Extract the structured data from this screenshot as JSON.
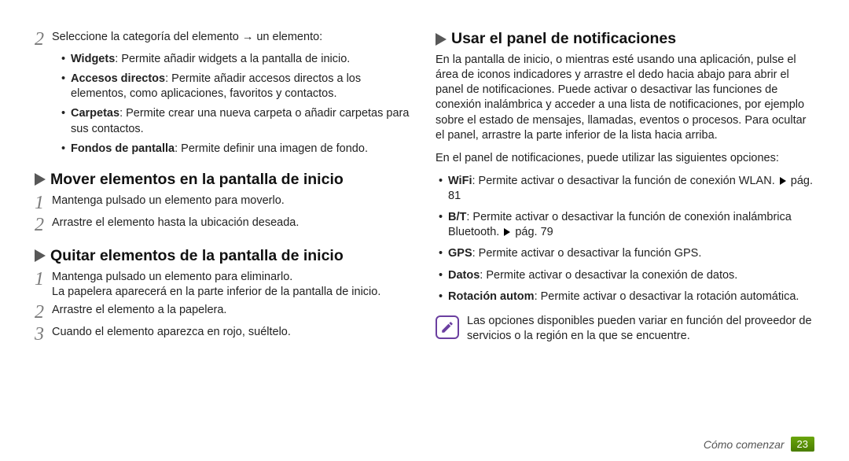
{
  "left": {
    "step2_intro": "Seleccione la categoría del elemento → un elemento:",
    "step2_num": "2",
    "bullets": [
      {
        "label": "Widgets",
        "text": ": Permite añadir widgets a la pantalla de inicio."
      },
      {
        "label": "Accesos directos",
        "text": ": Permite añadir accesos directos a los elementos, como aplicaciones, favoritos y contactos."
      },
      {
        "label": "Carpetas",
        "text": ": Permite crear una nueva carpeta o añadir carpetas para sus contactos."
      },
      {
        "label": "Fondos de pantalla",
        "text": ": Permite definir una imagen de fondo."
      }
    ],
    "sec_move_title": "Mover elementos en la pantalla de inicio",
    "move_steps": [
      {
        "num": "1",
        "text": "Mantenga pulsado un elemento para moverlo."
      },
      {
        "num": "2",
        "text": "Arrastre el elemento hasta la ubicación deseada."
      }
    ],
    "sec_remove_title": "Quitar elementos de la pantalla de inicio",
    "remove_steps": [
      {
        "num": "1",
        "text": "Mantenga pulsado un elemento para eliminarlo.",
        "extra": "La papelera aparecerá en la parte inferior de la pantalla de inicio."
      },
      {
        "num": "2",
        "text": "Arrastre el elemento a la papelera."
      },
      {
        "num": "3",
        "text": "Cuando el elemento aparezca en rojo, suéltelo."
      }
    ]
  },
  "right": {
    "sec_notif_title": "Usar el panel de notificaciones",
    "para1": "En la pantalla de inicio, o mientras esté usando una aplicación, pulse el área de iconos indicadores y arrastre el dedo hacia abajo para abrir el panel de notificaciones. Puede activar o desactivar las funciones de conexión inalámbrica y acceder a una lista de notificaciones, por ejemplo sobre el estado de mensajes, llamadas, eventos o procesos. Para ocultar el panel, arrastre la parte inferior de la lista hacia arriba.",
    "para2": "En el panel de notificaciones, puede utilizar las siguientes opciones:",
    "bullets": [
      {
        "label": "WiFi",
        "text_pre": ": Permite activar o desactivar la función de conexión WLAN. ",
        "page": "pág. 81"
      },
      {
        "label": "B/T",
        "text_pre": ": Permite activar o desactivar la función de conexión inalámbrica Bluetooth. ",
        "page": "pág. 79"
      },
      {
        "label": "GPS",
        "text_pre": ": Permite activar o desactivar la función GPS."
      },
      {
        "label": "Datos",
        "text_pre": ": Permite activar o desactivar la conexión de datos."
      },
      {
        "label": "Rotación autom",
        "text_pre": ": Permite activar o desactivar la rotación automática."
      }
    ],
    "note": "Las opciones disponibles pueden variar en función del proveedor de servicios o la región en la que se encuentre."
  },
  "footer": {
    "label": "Cómo comenzar",
    "page": "23"
  }
}
